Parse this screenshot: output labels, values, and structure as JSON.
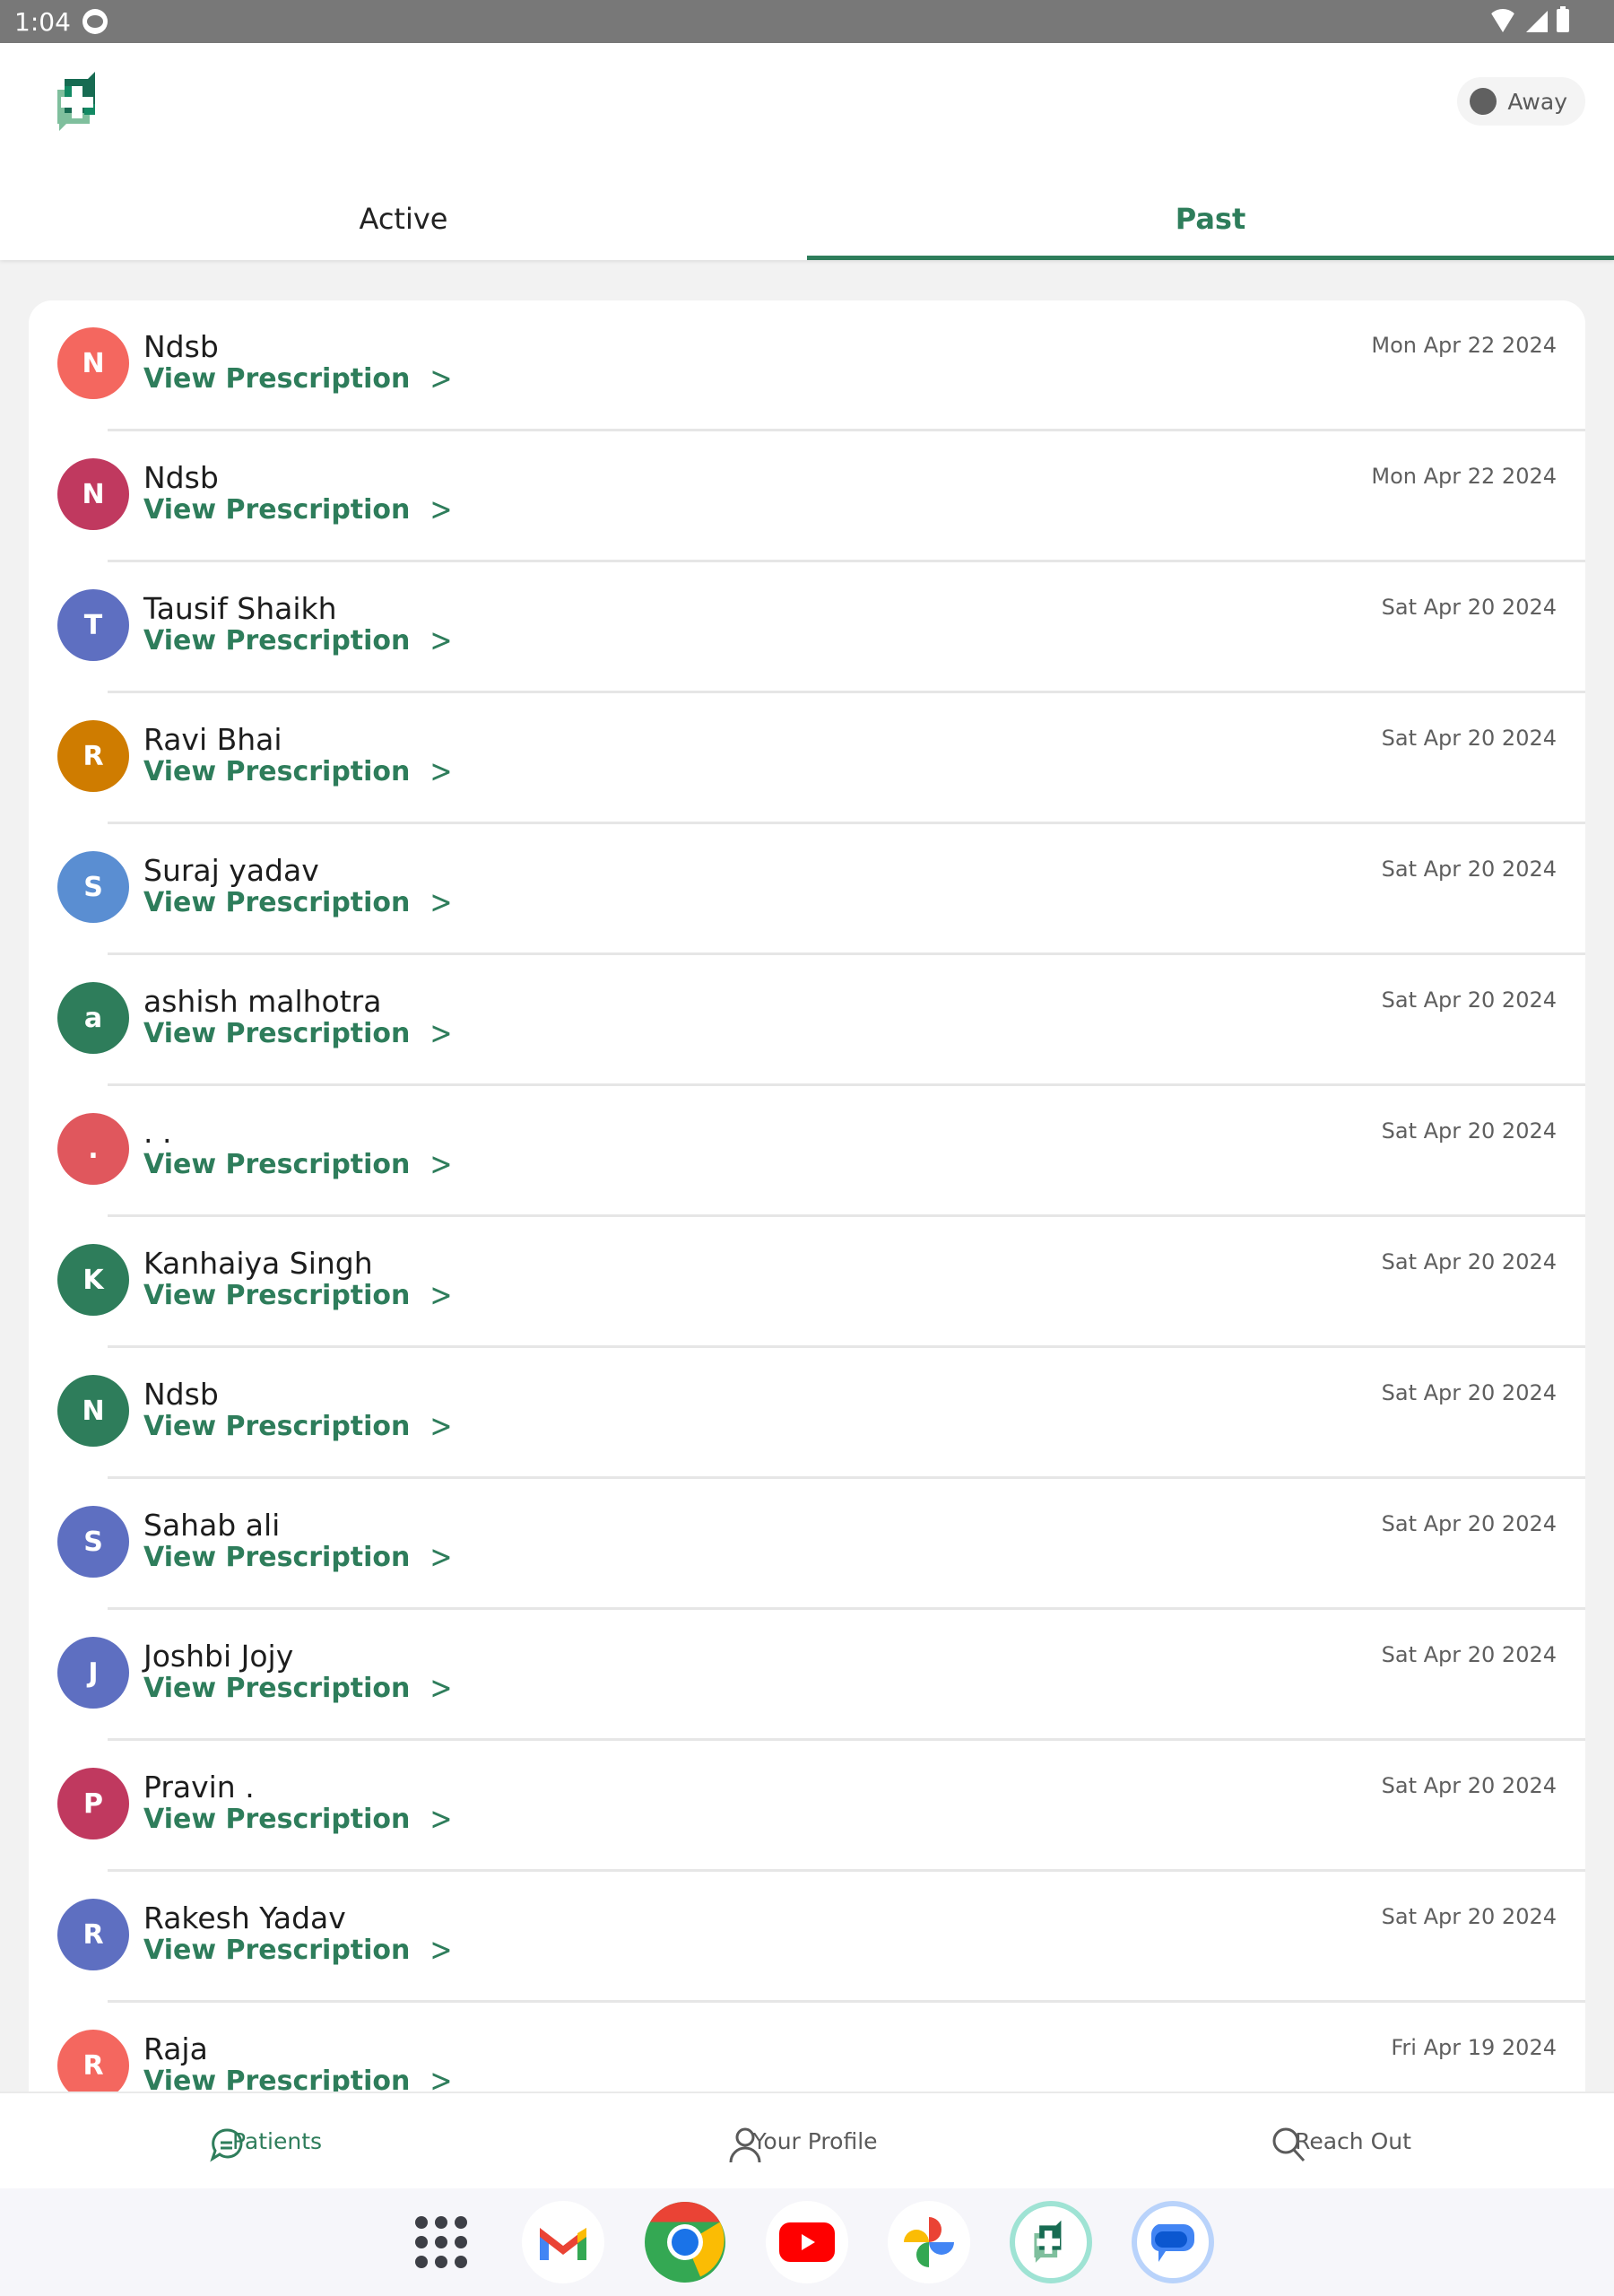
{
  "status_bar": {
    "time": "1:04"
  },
  "header": {
    "presence": {
      "label": "Away",
      "dot_color": "#606060"
    }
  },
  "tabs": [
    {
      "label": "Active",
      "active": false
    },
    {
      "label": "Past",
      "active": true
    }
  ],
  "accent_color": "#2e7d5b",
  "consultations": [
    {
      "initial": "N",
      "name": "Ndsb",
      "link": "View Prescription",
      "date": "Mon Apr 22 2024",
      "avatar_color": "#f4675f"
    },
    {
      "initial": "N",
      "name": "Ndsb",
      "link": "View Prescription",
      "date": "Mon Apr 22 2024",
      "avatar_color": "#c0395f"
    },
    {
      "initial": "T",
      "name": "Tausif Shaikh",
      "link": "View Prescription",
      "date": "Sat Apr 20 2024",
      "avatar_color": "#5e6fc1"
    },
    {
      "initial": "R",
      "name": "Ravi Bhai",
      "link": "View Prescription",
      "date": "Sat Apr 20 2024",
      "avatar_color": "#cf7c00"
    },
    {
      "initial": "S",
      "name": "Suraj yadav",
      "link": "View Prescription",
      "date": "Sat Apr 20 2024",
      "avatar_color": "#5a8ed2"
    },
    {
      "initial": "a",
      "name": "ashish malhotra",
      "link": "View Prescription",
      "date": "Sat Apr 20 2024",
      "avatar_color": "#2e7d5b"
    },
    {
      "initial": ".",
      "name": ". .",
      "link": "View Prescription",
      "date": "Sat Apr 20 2024",
      "avatar_color": "#e0575d"
    },
    {
      "initial": "K",
      "name": "Kanhaiya Singh",
      "link": "View Prescription",
      "date": "Sat Apr 20 2024",
      "avatar_color": "#2e7d5b"
    },
    {
      "initial": "N",
      "name": "Ndsb",
      "link": "View Prescription",
      "date": "Sat Apr 20 2024",
      "avatar_color": "#2e7d5b"
    },
    {
      "initial": "S",
      "name": "Sahab ali",
      "link": "View Prescription",
      "date": "Sat Apr 20 2024",
      "avatar_color": "#5e6fc1"
    },
    {
      "initial": "J",
      "name": "Joshbi Jojy",
      "link": "View Prescription",
      "date": "Sat Apr 20 2024",
      "avatar_color": "#5e6fc1"
    },
    {
      "initial": "P",
      "name": "Pravin .",
      "link": "View Prescription",
      "date": "Sat Apr 20 2024",
      "avatar_color": "#c0395f"
    },
    {
      "initial": "R",
      "name": "Rakesh Yadav",
      "link": "View Prescription",
      "date": "Sat Apr 20 2024",
      "avatar_color": "#5e6fc1"
    },
    {
      "initial": "R",
      "name": "Raja",
      "link": "View Prescription",
      "date": "Fri Apr 19 2024",
      "avatar_color": "#f4675f"
    }
  ],
  "bottom_nav": [
    {
      "label": "Patients",
      "icon": "chat-icon",
      "active": true
    },
    {
      "label": "Your Profile",
      "icon": "person-icon",
      "active": false
    },
    {
      "label": "Reach Out",
      "icon": "search-icon",
      "active": false
    }
  ],
  "dock": [
    "app-drawer",
    "gmail",
    "chrome",
    "youtube",
    "photos",
    "clinic-app",
    "messages"
  ]
}
